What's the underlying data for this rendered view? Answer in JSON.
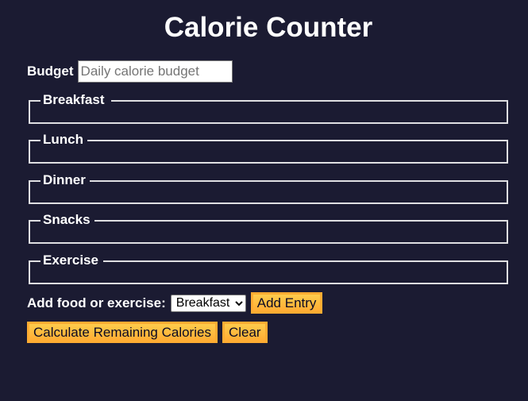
{
  "title": "Calorie Counter",
  "budget": {
    "label": "Budget",
    "placeholder": "Daily calorie budget",
    "value": ""
  },
  "sections": [
    {
      "legend": "Breakfast"
    },
    {
      "legend": "Lunch"
    },
    {
      "legend": "Dinner"
    },
    {
      "legend": "Snacks"
    },
    {
      "legend": "Exercise"
    }
  ],
  "entry": {
    "label": "Add food or exercise:",
    "selected": "Breakfast",
    "add_button": "Add Entry"
  },
  "actions": {
    "calculate_button": "Calculate Remaining Calories",
    "clear_button": "Clear"
  },
  "colors": {
    "background": "#1b1b32",
    "button": "#feac32",
    "text": "#ffffff"
  }
}
